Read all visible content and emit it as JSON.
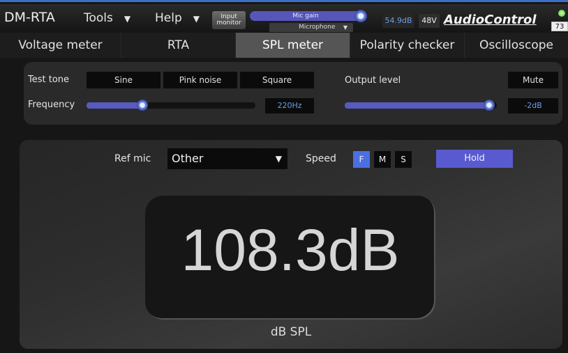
{
  "header": {
    "app_title": "DM-RTA",
    "menus": [
      {
        "label": "Tools"
      },
      {
        "label": "Help"
      }
    ],
    "input_monitor": "Input monitor",
    "mic_gain_label": "Mic gain",
    "mic_select": "Microphone",
    "level_readout": "54.9dB",
    "phantom": "48V",
    "logo_text": "AudioControl",
    "battery": "73"
  },
  "tabs": [
    {
      "label": "Voltage meter",
      "active": false
    },
    {
      "label": "RTA",
      "active": false
    },
    {
      "label": "SPL meter",
      "active": true
    },
    {
      "label": "Polarity checker",
      "active": false
    },
    {
      "label": "Oscilloscope",
      "active": false
    }
  ],
  "tone": {
    "test_tone_label": "Test tone",
    "buttons": [
      "Sine",
      "Pink noise",
      "Square"
    ],
    "output_level_label": "Output level",
    "mute_label": "Mute",
    "frequency_label": "Frequency",
    "frequency_value": "220Hz",
    "frequency_slider_fraction": 0.33,
    "output_value": "-2dB",
    "output_slider_fraction": 0.95
  },
  "spl": {
    "ref_mic_label": "Ref mic",
    "ref_mic_value": "Other",
    "speed_label": "Speed",
    "speed_options": [
      "F",
      "M",
      "S"
    ],
    "speed_active": "F",
    "hold_label": "Hold",
    "reading": "108.3dB",
    "unit_label": "dB SPL"
  },
  "colors": {
    "accent": "#5959c2",
    "value_text": "#6a9fe8",
    "window_border": "#3a6fc4"
  }
}
